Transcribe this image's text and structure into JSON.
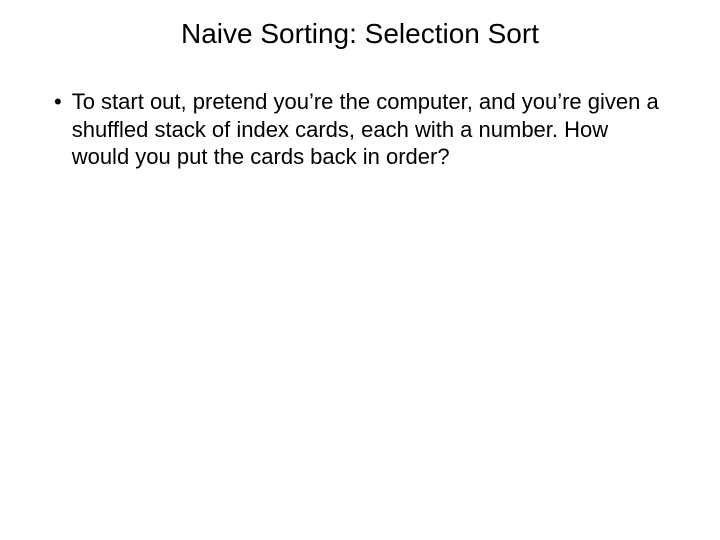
{
  "slide": {
    "title": "Naive Sorting: Selection Sort",
    "bullets": [
      {
        "marker": "•",
        "text": "To start out, pretend you’re the computer, and you’re given a shuffled stack of index cards, each with a number. How would you put the cards back in order?"
      }
    ]
  }
}
